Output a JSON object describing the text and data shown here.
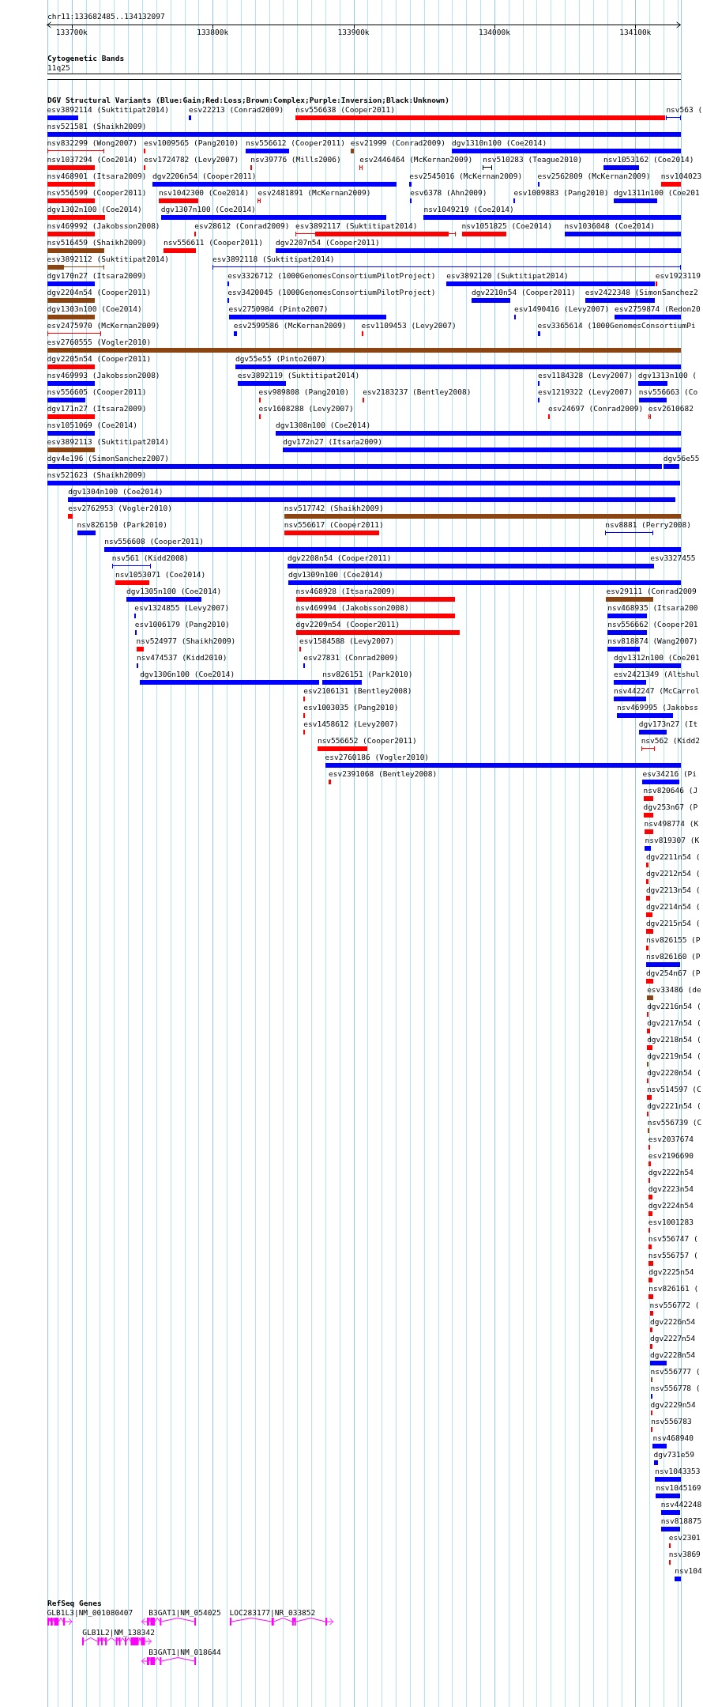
{
  "region": {
    "title": "chr11:133682485..134132097",
    "ticks": [
      {
        "label": "133700k"
      },
      {
        "label": "133800k"
      },
      {
        "label": "133900k"
      },
      {
        "label": "134000k"
      },
      {
        "label": "134100k"
      }
    ]
  },
  "cytogenetic_bands": {
    "title": "Cytogenetic Bands",
    "band": "11q25"
  },
  "sv_track": {
    "title": "DGV Structural Variants (Blue:Gain;Red:Loss;Brown:Complex;Purple:Inversion;Black:Unknown)",
    "rows": [
      {
        "features": [
          {
            "label": "esv3892114 (Suktitipat2014)",
            "kind": "box",
            "color": "#0000ff"
          },
          {
            "label": "esv22213 (Conrad2009)",
            "kind": "box",
            "color": "#0000ff"
          },
          {
            "label": "nsv556638 (Cooper2011)",
            "kind": "box",
            "color": "#ff0000"
          },
          {
            "label": "nsv563 (",
            "kind": "span",
            "color": "#0000ff"
          }
        ]
      },
      {
        "features": [
          {
            "label": "nsv521581 (Shaikh2009)",
            "kind": "box",
            "color": "#0000ff"
          }
        ]
      },
      {
        "features": [
          {
            "label": "nsv832299 (Wong2007)",
            "kind": "span",
            "color": "#ff0000"
          },
          {
            "label": "esv1009565 (Pang2010)",
            "kind": "box",
            "color": "#ff0000"
          },
          {
            "label": "nsv556612 (Cooper2011)",
            "kind": "box",
            "color": "#0000ff"
          },
          {
            "label": "esv21999 (Conrad2009)",
            "kind": "box",
            "color": "#8b4513"
          },
          {
            "label": "dgv1310n100 (Coe2014)",
            "kind": "box",
            "color": "#0000ff"
          }
        ]
      },
      {
        "features": [
          {
            "label": "nsv1037294 (Coe2014)",
            "kind": "box",
            "color": "#ff0000"
          },
          {
            "label": "esv1724782 (Levy2007)",
            "kind": "box",
            "color": "#ff0000"
          },
          {
            "label": "nsv39776 (Mills2006)",
            "kind": "box",
            "color": "#ff0000"
          },
          {
            "label": "esv2446464 (McKernan2009)",
            "kind": "span",
            "color": "#ff0000"
          },
          {
            "label": "nsv510283 (Teague2010)",
            "kind": "span",
            "color": "#000000"
          },
          {
            "label": "nsv1053162 (Coe2014)",
            "kind": "box",
            "color": "#0000ff"
          }
        ]
      },
      {
        "features": [
          {
            "label": "nsv468901 (Itsara2009)",
            "kind": "box",
            "color": "#ff0000"
          },
          {
            "label": "dgv2206n54 (Cooper2011)",
            "kind": "box",
            "color": "#0000ff"
          },
          {
            "label": "esv2545016 (McKernan2009)",
            "kind": "box",
            "color": "#0000ff"
          },
          {
            "label": "esv2562809 (McKernan2009)",
            "kind": "box",
            "color": "#0000ff"
          },
          {
            "label": "nsv104023",
            "kind": "box",
            "color": "#ff0000"
          }
        ]
      },
      {
        "features": [
          {
            "label": "nsv556599 (Cooper2011)",
            "kind": "box",
            "color": "#ff0000"
          },
          {
            "label": "nsv1042300 (Coe2014)",
            "kind": "box",
            "color": "#ff0000"
          },
          {
            "label": "esv2481891 (McKernan2009)",
            "kind": "span",
            "color": "#ff0000"
          },
          {
            "label": "esv6378 (Ahn2009)",
            "kind": "box",
            "color": "#0000ff"
          },
          {
            "label": "esv1009883 (Pang2010)",
            "kind": "box",
            "color": "#0000ff"
          },
          {
            "label": "dgv1311n100 (Coe201",
            "kind": "box",
            "color": "#0000ff"
          }
        ]
      },
      {
        "features": [
          {
            "label": "dgv1302n100 (Coe2014)",
            "kind": "box",
            "color": "#ff0000"
          },
          {
            "label": "dgv1307n100 (Coe2014)",
            "kind": "box",
            "color": "#0000ff"
          },
          {
            "label": "nsv1049219 (Coe2014)",
            "kind": "box",
            "color": "#0000ff"
          }
        ]
      },
      {
        "features": [
          {
            "label": "nsv469992 (Jakobsson2008)",
            "kind": "box",
            "color": "#ff0000"
          },
          {
            "label": "esv28612 (Conrad2009)",
            "kind": "box",
            "color": "#ff0000"
          },
          {
            "label": "esv3892117 (Suktitipat2014)",
            "kind": "span",
            "color": "#ff0000"
          },
          {
            "label": "nsv1051825 (Coe2014)",
            "kind": "box",
            "color": "#ff0000"
          },
          {
            "label": "nsv1036048 (Coe2014)",
            "kind": "box",
            "color": "#0000ff"
          }
        ]
      },
      {
        "features": [
          {
            "label": "nsv516459 (Shaikh2009)",
            "kind": "box",
            "color": "#8b4513"
          },
          {
            "label": "nsv556611 (Cooper2011)",
            "kind": "box",
            "color": "#ff0000"
          },
          {
            "label": "dgv2207n54 (Cooper2011)",
            "kind": "box",
            "color": "#0000ff"
          }
        ]
      },
      {
        "features": [
          {
            "label": "esv3892112 (Suktitipat2014)",
            "kind": "span",
            "color": "#8b4513"
          },
          {
            "label": "esv3892118 (Suktitipat2014)",
            "kind": "span",
            "color": "#0000ff"
          }
        ]
      },
      {
        "features": [
          {
            "label": "dgv170n27 (Itsara2009)",
            "kind": "box",
            "color": "#0000ff"
          },
          {
            "label": "esv3326712 (1000GenomesConsortiumPilotProject)",
            "kind": "box",
            "color": "#0000ff"
          },
          {
            "label": "esv3892120 (Suktitipat2014)",
            "kind": "box",
            "color": "#0000ff"
          },
          {
            "label": "esv1923119",
            "kind": "box",
            "color": "#ff0000"
          }
        ]
      },
      {
        "features": [
          {
            "label": "dgv2204n54 (Cooper2011)",
            "kind": "box",
            "color": "#8b4513"
          },
          {
            "label": "esv3420045 (1000GenomesConsortiumPilotProject)",
            "kind": "box",
            "color": "#0000ff"
          },
          {
            "label": "dgv2210n54 (Cooper2011)",
            "kind": "box",
            "color": "#0000ff"
          },
          {
            "label": "esv2422348 (SimonSanchez2",
            "kind": "box",
            "color": "#0000ff"
          }
        ]
      },
      {
        "features": [
          {
            "label": "dgv1303n100 (Coe2014)",
            "kind": "box",
            "color": "#8b4513"
          },
          {
            "label": "esv2750984 (Pinto2007)",
            "kind": "box",
            "color": "#0000ff"
          },
          {
            "label": "esv1490416 (Levy2007)",
            "kind": "box",
            "color": "#0000ff"
          },
          {
            "label": "esv2759874 (Redon20",
            "kind": "box",
            "color": "#0000ff"
          }
        ]
      },
      {
        "features": [
          {
            "label": "esv2475970 (McKernan2009)",
            "kind": "span",
            "color": "#ff0000"
          },
          {
            "label": "esv2599586 (McKernan2009)",
            "kind": "box",
            "color": "#0000ff"
          },
          {
            "label": "esv1109453 (Levy2007)",
            "kind": "box",
            "color": "#ff0000"
          },
          {
            "label": "esv3365614 (1000GenomesConsortiumPi",
            "kind": "box",
            "color": "#0000ff"
          }
        ]
      },
      {
        "features": [
          {
            "label": "esv2760555 (Vogler2010)",
            "kind": "box",
            "color": "#8b4513"
          }
        ]
      },
      {
        "features": [
          {
            "label": "dgv2205n54 (Cooper2011)",
            "kind": "box",
            "color": "#ff0000"
          },
          {
            "label": "dgv55e55 (Pinto2007)",
            "kind": "box",
            "color": "#0000ff"
          }
        ]
      },
      {
        "features": [
          {
            "label": "nsv469993 (Jakobsson2008)",
            "kind": "box",
            "color": "#0000ff"
          },
          {
            "label": "esv3892119 (Suktitipat2014)",
            "kind": "box",
            "color": "#0000ff"
          },
          {
            "label": "esv1184328 (Levy2007)",
            "kind": "box",
            "color": "#0000ff"
          },
          {
            "label": "dgv1313n100 (",
            "kind": "box",
            "color": "#0000ff"
          }
        ]
      },
      {
        "features": [
          {
            "label": "nsv556605 (Cooper2011)",
            "kind": "box",
            "color": "#0000ff"
          },
          {
            "label": "esv989808 (Pang2010)",
            "kind": "box",
            "color": "#ff0000"
          },
          {
            "label": "esv2183237 (Bentley2008)",
            "kind": "box",
            "color": "#ff0000"
          },
          {
            "label": "esv1219322 (Levy2007)",
            "kind": "box",
            "color": "#0000ff"
          },
          {
            "label": "nsv556663 (Co",
            "kind": "box",
            "color": "#0000ff"
          }
        ]
      },
      {
        "features": [
          {
            "label": "dgv171n27 (Itsara2009)",
            "kind": "box",
            "color": "#ff0000"
          },
          {
            "label": "esv1608288 (Levy2007)",
            "kind": "box",
            "color": "#ff0000"
          },
          {
            "label": "esv24697 (Conrad2009)",
            "kind": "box",
            "color": "#ff0000"
          },
          {
            "label": "esv2610682",
            "kind": "span",
            "color": "#ff0000"
          }
        ]
      },
      {
        "features": [
          {
            "label": "nsv1051069 (Coe2014)",
            "kind": "box",
            "color": "#0000ff"
          },
          {
            "label": "dgv1308n100 (Coe2014)",
            "kind": "box",
            "color": "#0000ff"
          }
        ]
      },
      {
        "features": [
          {
            "label": "esv3892113 (Suktitipat2014)",
            "kind": "box",
            "color": "#8b4513"
          },
          {
            "label": "dgv172n27 (Itsara2009)",
            "kind": "box",
            "color": "#0000ff"
          }
        ]
      },
      {
        "features": [
          {
            "label": "dgv4e196 (SimonSanchez2007)",
            "kind": "box",
            "color": "#0000ff"
          },
          {
            "label": "dgv56e55",
            "kind": "box",
            "color": "#0000ff"
          }
        ]
      },
      {
        "features": [
          {
            "label": "nsv521623 (Shaikh2009)",
            "kind": "box",
            "color": "#0000ff"
          }
        ]
      },
      {
        "features": [
          {
            "label": "dgv1304n100 (Coe2014)",
            "kind": "box",
            "color": "#0000ff"
          }
        ]
      },
      {
        "features": [
          {
            "label": "esv2762953 (Vogler2010)",
            "kind": "box",
            "color": "#ff0000"
          },
          {
            "label": "nsv517742 (Shaikh2009)",
            "kind": "box",
            "color": "#8b4513"
          }
        ]
      },
      {
        "features": [
          {
            "label": "nsv826150 (Park2010)",
            "kind": "box",
            "color": "#0000ff"
          },
          {
            "label": "nsv556617 (Cooper2011)",
            "kind": "box",
            "color": "#ff0000"
          },
          {
            "label": "nsv8881 (Perry2008)",
            "kind": "span",
            "color": "#0000ff"
          }
        ]
      },
      {
        "features": [
          {
            "label": "nsv556608 (Cooper2011)",
            "kind": "box",
            "color": "#0000ff"
          }
        ]
      },
      {
        "features": [
          {
            "label": "nsv561 (Kidd2008)",
            "kind": "span",
            "color": "#0000ff"
          },
          {
            "label": "dgv2208n54 (Cooper2011)",
            "kind": "box",
            "color": "#0000ff"
          },
          {
            "label": "esv3327455",
            "kind": "box",
            "color": "#0000ff"
          }
        ]
      },
      {
        "features": [
          {
            "label": "nsv1053071 (Coe2014)",
            "kind": "box",
            "color": "#ff0000"
          },
          {
            "label": "dgv1309n100 (Coe2014)",
            "kind": "box",
            "color": "#0000ff"
          }
        ]
      },
      {
        "features": [
          {
            "label": "dgv1305n100 (Coe2014)",
            "kind": "box",
            "color": "#0000ff"
          },
          {
            "label": "nsv468928 (Itsara2009)",
            "kind": "box",
            "color": "#ff0000"
          },
          {
            "label": "esv29111 (Conrad2009",
            "kind": "box",
            "color": "#8b4513"
          }
        ]
      },
      {
        "features": [
          {
            "label": "esv1324855 (Levy2007)",
            "kind": "box",
            "color": "#0000ff"
          },
          {
            "label": "nsv469994 (Jakobsson2008)",
            "kind": "box",
            "color": "#ff0000"
          },
          {
            "label": "nsv468935 (Itsara200",
            "kind": "box",
            "color": "#0000ff"
          }
        ]
      },
      {
        "features": [
          {
            "label": "esv1006179 (Pang2010)",
            "kind": "box",
            "color": "#0000ff"
          },
          {
            "label": "dgv2209n54 (Cooper2011)",
            "kind": "box",
            "color": "#ff0000"
          },
          {
            "label": "nsv556662 (Cooper201",
            "kind": "box",
            "color": "#0000ff"
          }
        ]
      },
      {
        "features": [
          {
            "label": "nsv524977 (Shaikh2009)",
            "kind": "box",
            "color": "#ff0000"
          },
          {
            "label": "esv1584588 (Levy2007)",
            "kind": "box",
            "color": "#ff0000"
          },
          {
            "label": "nsv818874 (Wang2007)",
            "kind": "box",
            "color": "#0000ff"
          }
        ]
      },
      {
        "features": [
          {
            "label": "nsv474537 (Kidd2010)",
            "kind": "box",
            "color": "#0000ff"
          },
          {
            "label": "esv27831 (Conrad2009)",
            "kind": "box",
            "color": "#0000ff"
          },
          {
            "label": "dgv1312n100 (Coe201",
            "kind": "box",
            "color": "#0000ff"
          }
        ]
      },
      {
        "features": [
          {
            "label": "dgv1306n100 (Coe2014)",
            "kind": "box",
            "color": "#0000ff"
          },
          {
            "label": "nsv826151 (Park2010)",
            "kind": "box",
            "color": "#0000ff"
          },
          {
            "label": "esv2421349 (Altshul",
            "kind": "box",
            "color": "#0000ff"
          }
        ]
      },
      {
        "features": [
          {
            "label": "esv2106131 (Bentley2008)",
            "kind": "box",
            "color": "#ff0000"
          },
          {
            "label": "nsv442247 (McCarrol",
            "kind": "box",
            "color": "#0000ff"
          }
        ]
      },
      {
        "features": [
          {
            "label": "esv1003035 (Pang2010)",
            "kind": "box",
            "color": "#ff0000"
          },
          {
            "label": "nsv469995 (Jakobss",
            "kind": "box",
            "color": "#0000ff"
          }
        ]
      },
      {
        "features": [
          {
            "label": "esv1458612 (Levy2007)",
            "kind": "box",
            "color": "#ff0000"
          },
          {
            "label": "dgv173n27 (It",
            "kind": "box",
            "color": "#0000ff"
          }
        ]
      },
      {
        "features": [
          {
            "label": "nsv556652 (Cooper2011)",
            "kind": "box",
            "color": "#ff0000"
          },
          {
            "label": "nsv562 (Kidd2",
            "kind": "span",
            "color": "#ff0000"
          }
        ]
      },
      {
        "features": [
          {
            "label": "esv2760186 (Vogler2010)",
            "kind": "box",
            "color": "#0000ff"
          }
        ]
      },
      {
        "features": [
          {
            "label": "esv2391068 (Bentley2008)",
            "kind": "box",
            "color": "#ff0000"
          },
          {
            "label": "esv34216 (Pi",
            "kind": "box",
            "color": "#0000ff"
          }
        ]
      },
      {
        "features": [
          {
            "label": "nsv820646 (J",
            "kind": "box",
            "color": "#ff0000"
          }
        ]
      },
      {
        "features": [
          {
            "label": "dgv253n67 (P",
            "kind": "box",
            "color": "#ff0000"
          }
        ]
      },
      {
        "features": [
          {
            "label": "nsv498774 (K",
            "kind": "box",
            "color": "#ff0000"
          }
        ]
      },
      {
        "features": [
          {
            "label": "nsv819307 (K",
            "kind": "box",
            "color": "#0000ff"
          }
        ]
      },
      {
        "features": [
          {
            "label": "dgv2211n54 (",
            "kind": "box",
            "color": "#ff0000"
          }
        ]
      },
      {
        "features": [
          {
            "label": "dgv2212n54 (",
            "kind": "box",
            "color": "#ff0000"
          }
        ]
      },
      {
        "features": [
          {
            "label": "dgv2213n54 (",
            "kind": "box",
            "color": "#ff0000"
          }
        ]
      },
      {
        "features": [
          {
            "label": "dgv2214n54 (",
            "kind": "box",
            "color": "#ff0000"
          }
        ]
      },
      {
        "features": [
          {
            "label": "dgv2215n54 (",
            "kind": "box",
            "color": "#ff0000"
          }
        ]
      },
      {
        "features": [
          {
            "label": "nsv826155 (P",
            "kind": "box",
            "color": "#ff0000"
          }
        ]
      },
      {
        "features": [
          {
            "label": "nsv826160 (P",
            "kind": "box",
            "color": "#0000ff"
          }
        ]
      },
      {
        "features": [
          {
            "label": "dgv254n67 (P",
            "kind": "box",
            "color": "#ff0000"
          }
        ]
      },
      {
        "features": [
          {
            "label": "esv33486 (de",
            "kind": "box",
            "color": "#8b4513"
          }
        ]
      },
      {
        "features": [
          {
            "label": "dgv2216n54 (",
            "kind": "box",
            "color": "#ff0000"
          }
        ]
      },
      {
        "features": [
          {
            "label": "dgv2217n54 (",
            "kind": "box",
            "color": "#ff0000"
          }
        ]
      },
      {
        "features": [
          {
            "label": "dgv2218n54 (",
            "kind": "box",
            "color": "#ff0000"
          }
        ]
      },
      {
        "features": [
          {
            "label": "dgv2219n54 (",
            "kind": "box",
            "color": "#8b4513"
          }
        ]
      },
      {
        "features": [
          {
            "label": "dgv2220n54 (",
            "kind": "box",
            "color": "#ff0000"
          }
        ]
      },
      {
        "features": [
          {
            "label": "nsv514597 (C",
            "kind": "box",
            "color": "#ff0000"
          }
        ]
      },
      {
        "features": [
          {
            "label": "dgv2221n54 (",
            "kind": "box",
            "color": "#ff0000"
          }
        ]
      },
      {
        "features": [
          {
            "label": "nsv556739 (C",
            "kind": "box",
            "color": "#8b4513"
          }
        ]
      },
      {
        "features": [
          {
            "label": "esv2037674",
            "kind": "box",
            "color": "#ff0000"
          }
        ]
      },
      {
        "features": [
          {
            "label": "esv2196690",
            "kind": "box",
            "color": "#ff0000"
          }
        ]
      },
      {
        "features": [
          {
            "label": "dgv2222n54",
            "kind": "box",
            "color": "#ff0000"
          }
        ]
      },
      {
        "features": [
          {
            "label": "dgv2223n54",
            "kind": "box",
            "color": "#ff0000"
          }
        ]
      },
      {
        "features": [
          {
            "label": "dgv2224n54",
            "kind": "box",
            "color": "#ff0000"
          }
        ]
      },
      {
        "features": [
          {
            "label": "esv1001283",
            "kind": "box",
            "color": "#ff0000"
          }
        ]
      },
      {
        "features": [
          {
            "label": "nsv556747 (",
            "kind": "box",
            "color": "#ff0000"
          }
        ]
      },
      {
        "features": [
          {
            "label": "nsv556757 (",
            "kind": "box",
            "color": "#ff0000"
          }
        ]
      },
      {
        "features": [
          {
            "label": "dgv2225n54",
            "kind": "box",
            "color": "#ff0000"
          }
        ]
      },
      {
        "features": [
          {
            "label": "nsv826161 (",
            "kind": "box",
            "color": "#ff0000"
          }
        ]
      },
      {
        "features": [
          {
            "label": "nsv556772 (",
            "kind": "box",
            "color": "#ff0000"
          }
        ]
      },
      {
        "features": [
          {
            "label": "dgv2226n54",
            "kind": "box",
            "color": "#ff0000"
          }
        ]
      },
      {
        "features": [
          {
            "label": "dgv2227n54",
            "kind": "box",
            "color": "#ff0000"
          }
        ]
      },
      {
        "features": [
          {
            "label": "dgv2228n54",
            "kind": "box",
            "color": "#0000ff"
          }
        ]
      },
      {
        "features": [
          {
            "label": "nsv556777 (",
            "kind": "box",
            "color": "#8b4513"
          }
        ]
      },
      {
        "features": [
          {
            "label": "nsv556778 (",
            "kind": "box",
            "color": "#0000ff"
          }
        ]
      },
      {
        "features": [
          {
            "label": "dgv2229n54",
            "kind": "box",
            "color": "#ff0000"
          }
        ]
      },
      {
        "features": [
          {
            "label": "nsv556783",
            "kind": "box",
            "color": "#ff0000"
          }
        ]
      },
      {
        "features": [
          {
            "label": "nsv468940",
            "kind": "box",
            "color": "#0000ff"
          }
        ]
      },
      {
        "features": [
          {
            "label": "dgv731e59",
            "kind": "box",
            "color": "#0000ff"
          }
        ]
      },
      {
        "features": [
          {
            "label": "nsv1043353",
            "kind": "box",
            "color": "#0000ff"
          }
        ]
      },
      {
        "features": [
          {
            "label": "nsv1045169",
            "kind": "box",
            "color": "#0000ff"
          }
        ]
      },
      {
        "features": [
          {
            "label": "nsv442248",
            "kind": "box",
            "color": "#0000ff"
          }
        ]
      },
      {
        "features": [
          {
            "label": "nsv818875",
            "kind": "box",
            "color": "#0000ff"
          }
        ]
      },
      {
        "features": [
          {
            "label": "esv2301",
            "kind": "box",
            "color": "#ff0000"
          }
        ]
      },
      {
        "features": [
          {
            "label": "nsv3869",
            "kind": "box",
            "color": "#ff0000"
          }
        ]
      },
      {
        "features": [
          {
            "label": "nsv104",
            "kind": "box",
            "color": "#0000ff"
          }
        ]
      }
    ]
  },
  "refseq_track": {
    "title": "RefSeq Genes",
    "rows": [
      {
        "genes": [
          {
            "label": "GLB1L3|NM_001080407",
            "reverse_strand": false
          },
          {
            "label": "B3GAT1|NM_054025",
            "reverse_strand": true
          },
          {
            "label": "LOC283177|NR_033852",
            "reverse_strand": false
          }
        ]
      },
      {
        "genes": [
          {
            "label": "GLB1L2|NM_138342",
            "reverse_strand": false
          }
        ]
      },
      {
        "genes": [
          {
            "label": "B3GAT1|NM_018644",
            "reverse_strand": true
          }
        ]
      }
    ]
  }
}
